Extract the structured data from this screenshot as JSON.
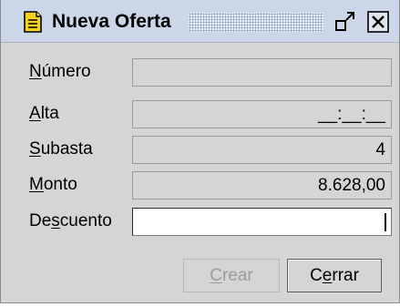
{
  "window": {
    "title": "Nueva Oferta",
    "icon": "document-icon",
    "controls": [
      "restore-icon",
      "close-icon"
    ]
  },
  "form": {
    "numero": {
      "label_mnemonic": "N",
      "label_rest": "úmero",
      "value": ""
    },
    "alta": {
      "label_mnemonic": "A",
      "label_rest": "lta",
      "value": "__:__:__"
    },
    "subasta": {
      "label_mnemonic": "S",
      "label_rest": "ubasta",
      "value": "4"
    },
    "monto": {
      "label_mnemonic": "M",
      "label_rest": "onto",
      "value": "8.628,00"
    },
    "descuento": {
      "label_pre": "De",
      "label_mnemonic": "s",
      "label_rest": "cuento",
      "value": ""
    }
  },
  "buttons": {
    "crear": {
      "label_mnemonic": "C",
      "label_rest": "rear",
      "enabled": false
    },
    "cerrar": {
      "label_pre": "C",
      "label_mnemonic": "e",
      "label_rest": "rrar",
      "enabled": true
    }
  },
  "colors": {
    "titlebar": "#cbd7e9",
    "panel": "#d5d5d5",
    "icon_yellow": "#f2d21b"
  }
}
